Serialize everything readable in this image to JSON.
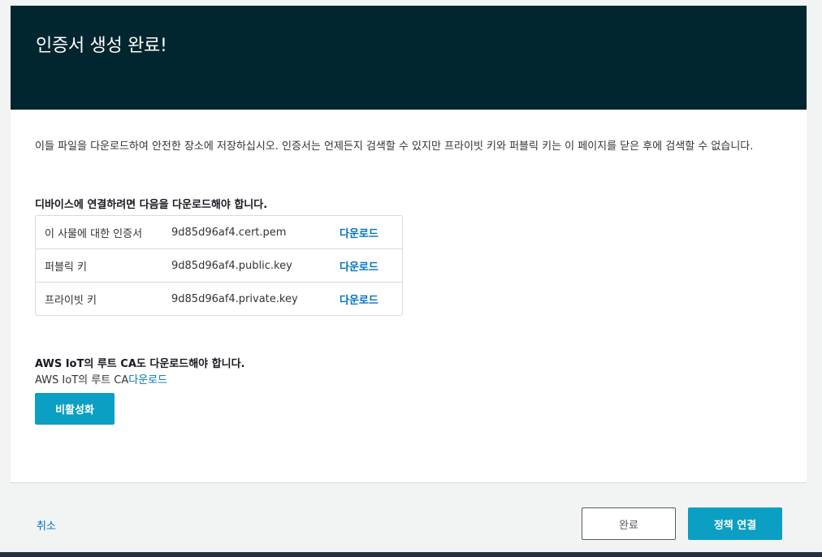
{
  "header": {
    "title": "인증서 생성 완료!"
  },
  "content": {
    "intro": "이들 파일을 다운로드하여 안전한 장소에 저장하십시오. 인증서는 언제든지 검색할 수 있지만 프라이빗 키와 퍼블릭 키는 이 페이지를 닫은 후에 검색할 수 없습니다.",
    "download_heading": "디바이스에 연결하려면 다음을 다운로드해야 합니다.",
    "files": [
      {
        "label": "이 사물에 대한 인증서",
        "filename": "9d85d96af4.cert.pem",
        "link": "다운로드"
      },
      {
        "label": "퍼블릭 키",
        "filename": "9d85d96af4.public.key",
        "link": "다운로드"
      },
      {
        "label": "프라이빗 키",
        "filename": "9d85d96af4.private.key",
        "link": "다운로드"
      }
    ],
    "root_ca_heading": "AWS IoT의 루트 CA도 다운로드해야 합니다.",
    "root_ca_text": "AWS IoT의 루트 CA",
    "root_ca_link": "다운로드",
    "deactivate_button": "비활성화"
  },
  "footer": {
    "cancel_label": "취소",
    "done_label": "완료",
    "attach_policy_label": "정책 연결"
  },
  "colors": {
    "header_bg": "#02262f",
    "primary_button": "#0a9fc3",
    "link": "#0073bb"
  }
}
